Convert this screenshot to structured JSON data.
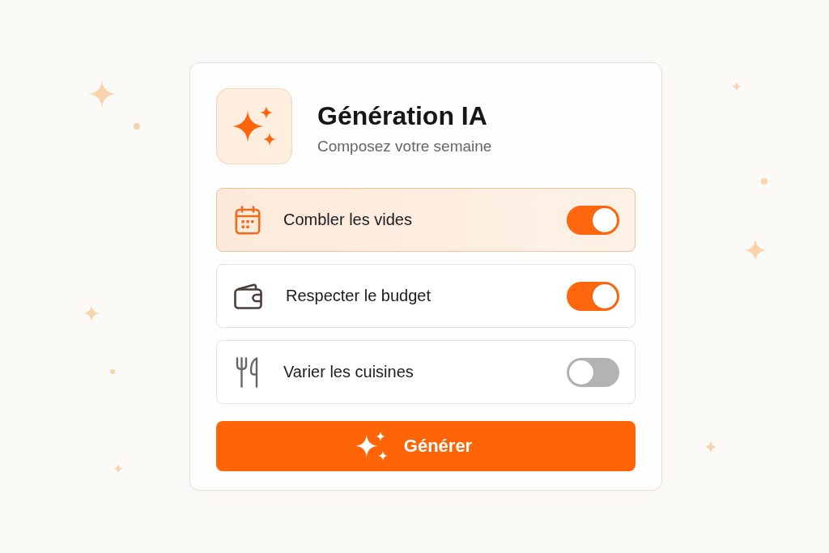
{
  "header": {
    "title": "Génération IA",
    "subtitle": "Composez votre semaine"
  },
  "options": [
    {
      "label": "Combler les vides",
      "selected": true,
      "on": true
    },
    {
      "label": "Respecter le budget",
      "selected": false,
      "on": true
    },
    {
      "label": "Varier les cuisines",
      "selected": false,
      "on": false
    }
  ],
  "generate_button": {
    "label": "Générer"
  }
}
